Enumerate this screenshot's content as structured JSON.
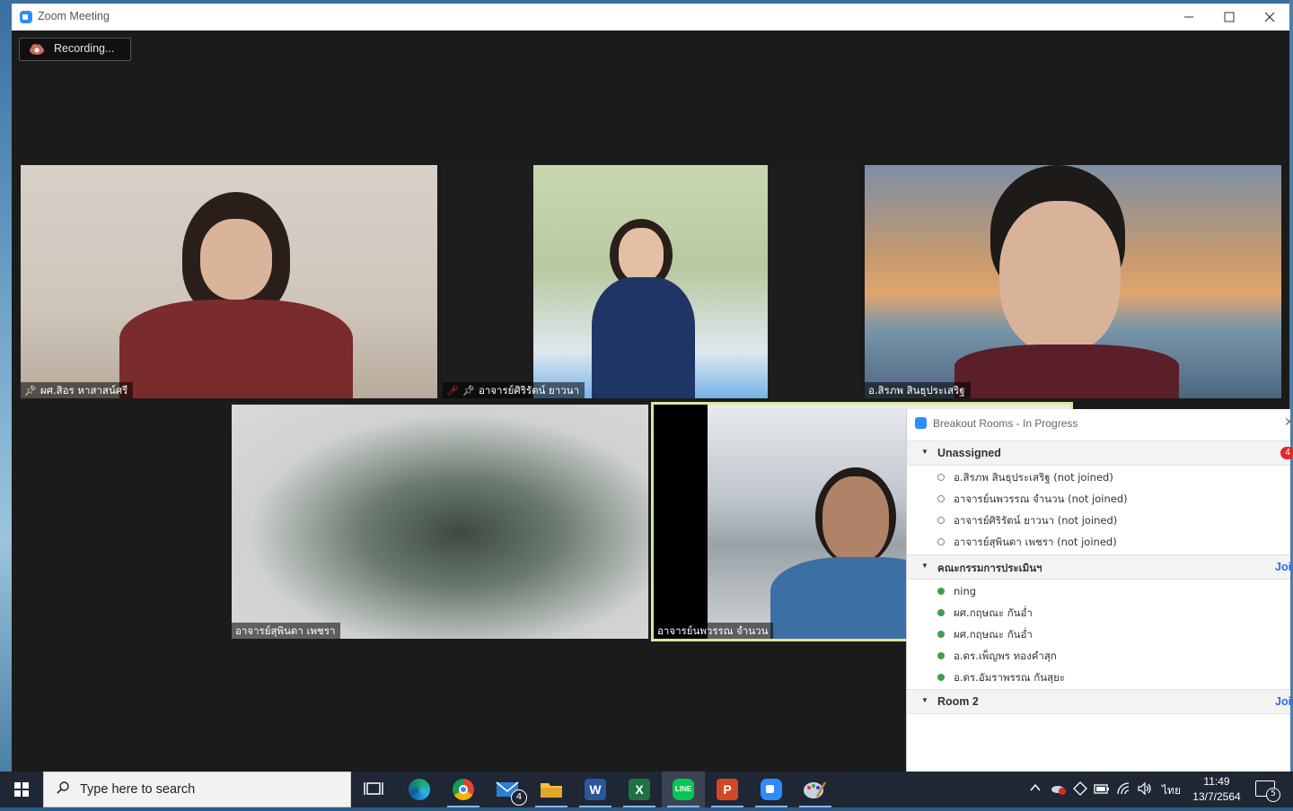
{
  "window": {
    "title": "Zoom Meeting"
  },
  "recording": {
    "label": "Recording..."
  },
  "tiles": [
    {
      "name": "ผศ.สิอร หาสาสน์ศรี"
    },
    {
      "name": "อาจารย์ศิริรัตน์ ยาวนา"
    },
    {
      "name": "อ.สิรภพ สินธุประเสริฐ"
    },
    {
      "name": "อาจารย์สุพินดา เพชรา"
    },
    {
      "name": "อาจารย์นพวรรณ จำนวน"
    }
  ],
  "breakout": {
    "title": "Breakout Rooms - In Progress",
    "rooms": [
      {
        "name": "Unassigned",
        "badge": "4",
        "members": [
          "อ.สิรภพ สินธุประเสริฐ (not joined)",
          "อาจารย์นพวรรณ จำนวน (not joined)",
          "อาจารย์ศิริรัตน์ ยาวนา (not joined)",
          "อาจารย์สุพินดา เพชรา (not joined)"
        ]
      },
      {
        "name": "คณะกรรมการประเมินฯ",
        "action": "Join",
        "members": [
          "ning",
          "ผศ.กฤษณะ กันอ่ำ",
          "ผศ.กฤษณะ กันอ่ำ",
          "อ.ดร.เพ็ญพร ทองคำสุก",
          "อ.ดร.อัมราพรรณ กันสุยะ"
        ]
      },
      {
        "name": "Room 2",
        "action": "Join",
        "members": []
      }
    ]
  },
  "taskbar": {
    "search_placeholder": "Type here to search",
    "mail_badge": "4",
    "language": "ไทย",
    "time": "11:49",
    "date": "13/7/2564",
    "notifications": "5"
  },
  "colors": {
    "zoom_blue": "#2d8cff",
    "active_speaker_border": "#d8e89a",
    "joined_dot": "#3aa14a",
    "badge_red": "#e02828",
    "join_link": "#2d6cdf"
  }
}
